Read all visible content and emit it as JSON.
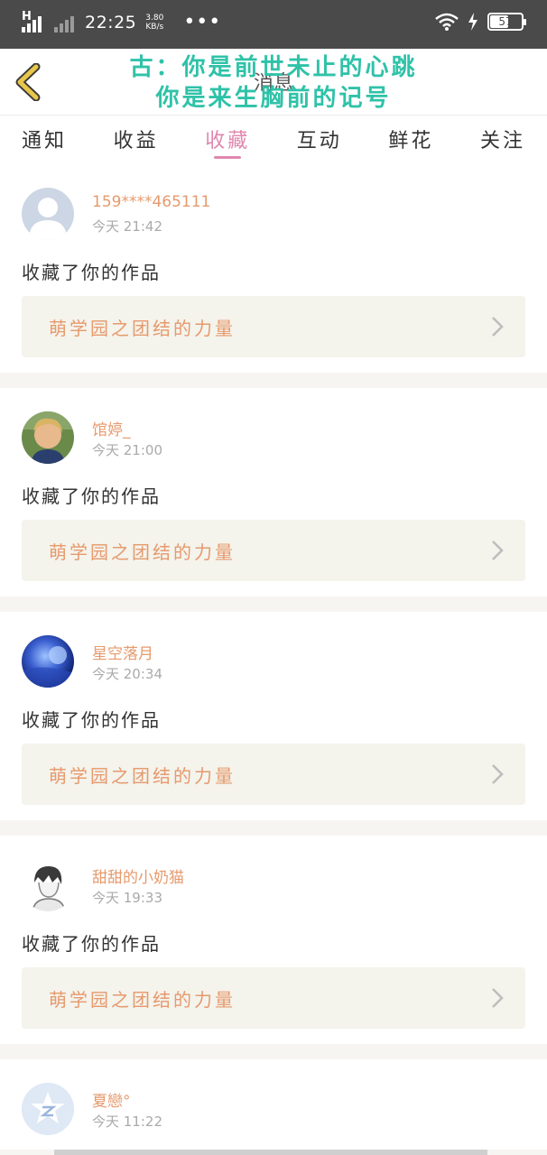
{
  "status_bar": {
    "network": "H",
    "time": "22:25",
    "speed_value": "3.80",
    "speed_unit": "KB/s",
    "more": "•••",
    "battery": "57"
  },
  "header": {
    "title": "消息",
    "overlay_line1": "古：你是前世未止的心跳",
    "overlay_line2": "你是来生胸前的记号"
  },
  "tabs": [
    {
      "label": "通知",
      "active": false
    },
    {
      "label": "收益",
      "active": false
    },
    {
      "label": "收藏",
      "active": true
    },
    {
      "label": "互动",
      "active": false
    },
    {
      "label": "鲜花",
      "active": false
    },
    {
      "label": "关注",
      "active": false
    }
  ],
  "notifications": [
    {
      "username": "159****465111",
      "time": "今天 21:42",
      "action": "收藏了你的作品",
      "work_title": "萌学园之团结的力量",
      "avatar": "default-avatar-icon"
    },
    {
      "username": "馆婷_",
      "time": "今天 21:00",
      "action": "收藏了你的作品",
      "work_title": "萌学园之团结的力量",
      "avatar": "child-photo"
    },
    {
      "username": "星空落月",
      "time": "今天 20:34",
      "action": "收藏了你的作品",
      "work_title": "萌学园之团结的力量",
      "avatar": "galaxy-photo"
    },
    {
      "username": "甜甜的小奶猫",
      "time": "今天 19:33",
      "action": "收藏了你的作品",
      "work_title": "萌学园之团结的力量",
      "avatar": "anime-sketch"
    },
    {
      "username": "夏戀°",
      "time": "今天 11:22",
      "action": "",
      "work_title": "",
      "avatar": "qzone-star-icon"
    }
  ],
  "colors": {
    "accent_pink": "#e087ae",
    "username_orange": "#e69a6d",
    "overlay_teal": "#2fc2a8",
    "back_yellow": "#e8c64b"
  }
}
